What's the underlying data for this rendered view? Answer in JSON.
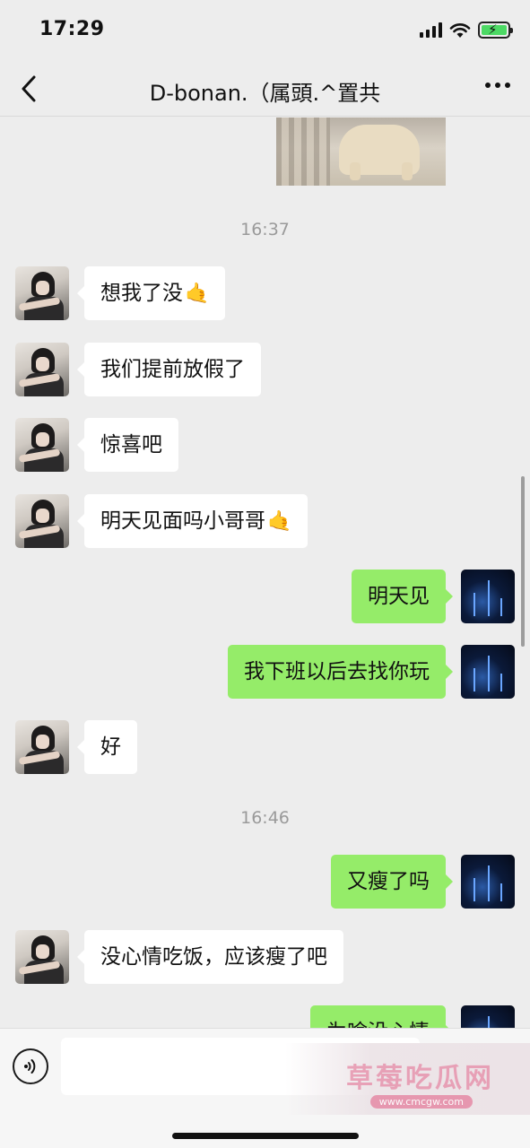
{
  "status_bar": {
    "time": "17:29",
    "battery_state": "charging"
  },
  "nav": {
    "title": "D-bonan.（属頭.^置共",
    "back_icon": "chevron-left-icon",
    "more_icon": "more-dots-icon"
  },
  "chat": {
    "timestamps": [
      "16:37",
      "16:46"
    ],
    "messages": [
      {
        "side": "in",
        "text": "想我了没",
        "emoji": "🤙"
      },
      {
        "side": "in",
        "text": "我们提前放假了"
      },
      {
        "side": "in",
        "text": "惊喜吧"
      },
      {
        "side": "in",
        "text": "明天见面吗小哥哥",
        "emoji": "🤙"
      },
      {
        "side": "out",
        "text": "明天见"
      },
      {
        "side": "out",
        "text": "我下班以后去找你玩"
      },
      {
        "side": "in",
        "text": "好"
      },
      {
        "side": "out",
        "text": "又瘦了吗"
      },
      {
        "side": "in",
        "text": "没心情吃饭，应该瘦了吧"
      },
      {
        "side": "out",
        "text": "为啥没心情"
      }
    ]
  },
  "input_bar": {
    "voice_icon": "voice-icon",
    "placeholder": ""
  },
  "watermark": {
    "title": "草莓吃瓜网",
    "url": "www.cmcgw.com"
  },
  "colors": {
    "incoming_bubble": "#ffffff",
    "outgoing_bubble": "#95ec69",
    "background": "#ededed"
  }
}
